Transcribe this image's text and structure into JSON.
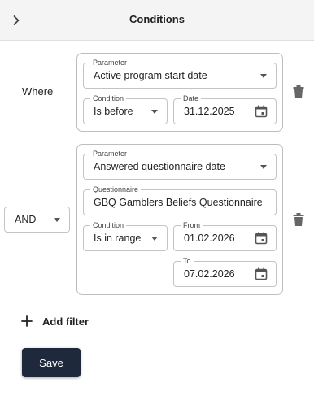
{
  "header": {
    "title": "Conditions",
    "collapse_icon": "chevron-right-icon"
  },
  "filter1": {
    "prefix": "Where",
    "parameter": {
      "label": "Parameter",
      "value": "Active program start date"
    },
    "condition": {
      "label": "Condition",
      "value": "Is before"
    },
    "date": {
      "label": "Date",
      "value": "31.12.2025"
    }
  },
  "filter2": {
    "operator": "AND",
    "parameter": {
      "label": "Parameter",
      "value": "Answered questionnaire date"
    },
    "questionnaire": {
      "label": "Questionnaire",
      "value": "GBQ Gamblers Beliefs Questionnaire"
    },
    "condition": {
      "label": "Condition",
      "value": "Is in range"
    },
    "from": {
      "label": "From",
      "value": "01.02.2026"
    },
    "to": {
      "label": "To",
      "value": "07.02.2026"
    }
  },
  "actions": {
    "add_filter": "Add filter",
    "save": "Save"
  },
  "colors": {
    "primary": "#1e2a3b",
    "header_bg": "#f4f4f4",
    "border": "#c4c4c4",
    "icon": "#555555"
  }
}
